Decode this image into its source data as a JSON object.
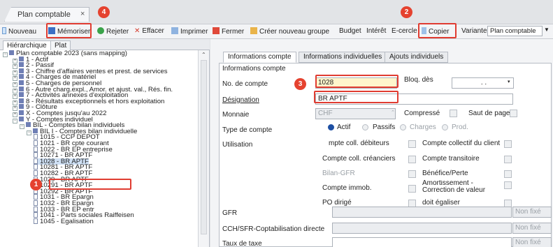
{
  "window": {
    "tab_title": "Plan comptable",
    "close_label": "×"
  },
  "toolbar": {
    "items": [
      {
        "label": "Nouveau"
      },
      {
        "label": "Mémoriser"
      },
      {
        "label": "Rejeter"
      },
      {
        "label": "Effacer"
      },
      {
        "label": "Imprimer"
      },
      {
        "label": "Fermer"
      },
      {
        "label": "Créer nouveau groupe"
      },
      {
        "label": "Budget"
      },
      {
        "label": "Intérêt"
      },
      {
        "label": "E-cercle"
      },
      {
        "label": "Copier"
      }
    ],
    "variant_label": "Variante:",
    "variant_value": "Plan comptable"
  },
  "left": {
    "tabs": [
      "Hiérarchique",
      "Plat"
    ],
    "tree": [
      {
        "t": "Plan comptable 2023 (sans mapping)",
        "lvl": 0,
        "kind": "root"
      },
      {
        "t": "1 - Actif",
        "lvl": 1,
        "kind": "folder"
      },
      {
        "t": "2 - Passif",
        "lvl": 1,
        "kind": "folder"
      },
      {
        "t": "3 - Chiffre d'affaires ventes et prest. de services",
        "lvl": 1,
        "kind": "folder"
      },
      {
        "t": "4 - Charges de matériel",
        "lvl": 1,
        "kind": "folder"
      },
      {
        "t": "5 - Charges de personnel",
        "lvl": 1,
        "kind": "folder"
      },
      {
        "t": "6 - Autre charg.expl., Amor. et ajust. val., Rés. fin.",
        "lvl": 1,
        "kind": "folder"
      },
      {
        "t": "7 - Activités annexes d'exploitation",
        "lvl": 1,
        "kind": "folder"
      },
      {
        "t": "8 - Résultats exceptionnels et hors exploitation",
        "lvl": 1,
        "kind": "folder"
      },
      {
        "t": "9 - Clôture",
        "lvl": 1,
        "kind": "folder"
      },
      {
        "t": "X - Comptes jusqu'au 2022",
        "lvl": 1,
        "kind": "folder"
      },
      {
        "t": "Y - Comptes individuel",
        "lvl": 1,
        "kind": "folder"
      },
      {
        "t": "BIL - Comptes bilan individuels",
        "lvl": 2,
        "kind": "folder"
      },
      {
        "t": "BIL I - Comptes bilan individuelle",
        "lvl": 3,
        "kind": "folder"
      },
      {
        "t": "1015 - CCP DEPOT",
        "lvl": 4,
        "kind": "page"
      },
      {
        "t": "1021 - BR cpte courant",
        "lvl": 4,
        "kind": "page"
      },
      {
        "t": "1022 - BR EP entreprise",
        "lvl": 4,
        "kind": "page"
      },
      {
        "t": "10271 - BR APTF",
        "lvl": 4,
        "kind": "page"
      },
      {
        "t": "1028 - BR APTF",
        "lvl": 4,
        "kind": "page",
        "selected": true
      },
      {
        "t": "10281 - BR APTF",
        "lvl": 4,
        "kind": "page"
      },
      {
        "t": "10282 - BR APTF",
        "lvl": 4,
        "kind": "page"
      },
      {
        "t": "1029 - BR APTF",
        "lvl": 4,
        "kind": "page"
      },
      {
        "t": "10291 - BR APTF",
        "lvl": 4,
        "kind": "page"
      },
      {
        "t": "10292 - BR APTF",
        "lvl": 4,
        "kind": "page"
      },
      {
        "t": "1031 - BR Epargn",
        "lvl": 4,
        "kind": "page"
      },
      {
        "t": "1032 - BR Epargn",
        "lvl": 4,
        "kind": "page"
      },
      {
        "t": "1033 - BR EP entr",
        "lvl": 4,
        "kind": "page"
      },
      {
        "t": "1041 - Parts sociales Raiffeisen",
        "lvl": 4,
        "kind": "page"
      },
      {
        "t": "1045 - Egalisation",
        "lvl": 4,
        "kind": "page"
      }
    ]
  },
  "right": {
    "tabs": [
      "Informations compte",
      "Informations individuelles",
      "Ajouts individuels"
    ],
    "group_title": "Informations compte",
    "no_compte_label": "No. de compte",
    "no_compte_value": "1028",
    "bloq_label": "Bloq. dès",
    "bloq_value": ". .",
    "designation_label": "Désignation",
    "designation_value": "BR APTF",
    "monnaie_label": "Monnaie",
    "monnaie_value": "CHF",
    "compresse_label": "Compressé",
    "saut_label": "Saut de page",
    "type_label": "Type de compte",
    "type_options": [
      "Actif",
      "Passifs",
      "Charges",
      "Prod."
    ],
    "utilisation_label": "Utilisation",
    "util_left": [
      "mpte coll. débiteurs",
      "Compte coll. créanciers",
      "Bilan-GFR",
      "Compte immob.",
      "PO dirigé"
    ],
    "util_right": [
      "Compte collectif du client",
      "Compte transitoire",
      "Bénéfice/Perte",
      "Amortissement - Correction de valeur",
      "doit égaliser"
    ],
    "gfr_label": "GFR",
    "cch_label": "CCH/SFR-Coptabilisation directe",
    "taux_label": "Taux de taxe",
    "non_fixe": "Non fixé"
  },
  "annotations": [
    "1",
    "2",
    "3",
    "4"
  ],
  "colors": {
    "accent_red": "#e03c31",
    "badge_red": "#e5422f",
    "selection": "#cfe0f4",
    "input_yellow": "#fff6cc"
  }
}
